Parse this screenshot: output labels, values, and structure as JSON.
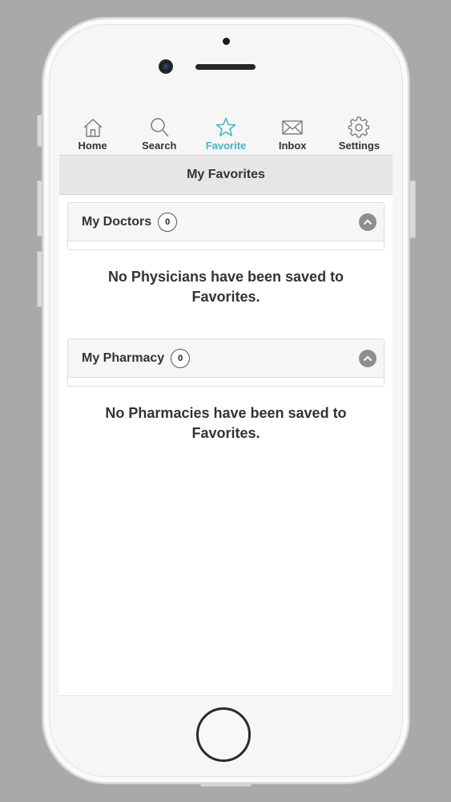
{
  "tabs": [
    {
      "label": "Home",
      "icon": "home-icon"
    },
    {
      "label": "Search",
      "icon": "search-icon"
    },
    {
      "label": "Favorite",
      "icon": "star-icon",
      "active": true
    },
    {
      "label": "Inbox",
      "icon": "envelope-icon"
    },
    {
      "label": "Settings",
      "icon": "gear-icon"
    }
  ],
  "page_title": "My Favorites",
  "doctors": {
    "title": "My Doctors",
    "count": "0",
    "empty_line1": "No Physicians have been saved to",
    "empty_line2": "Favorites."
  },
  "pharmacy": {
    "title": "My Pharmacy",
    "count": "0",
    "empty_line1": "No Pharmacies have been saved to",
    "empty_line2": "Favorites."
  },
  "colors": {
    "accent": "#3fb7c4",
    "background": "#a9a8aa",
    "header_bg": "#e6e6e6"
  }
}
